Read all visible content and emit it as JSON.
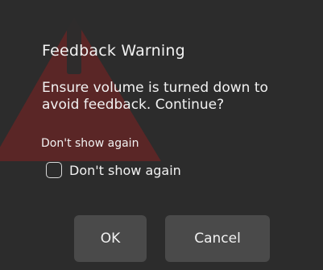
{
  "dialog": {
    "title": "Feedback Warning",
    "message": "Ensure volume is turned down to avoid feedback. Continue?",
    "hint": "Don't show again",
    "checkbox": {
      "label": "Don't show again",
      "checked": false
    },
    "buttons": {
      "ok": "OK",
      "cancel": "Cancel"
    },
    "background_icon": "warning-triangle-icon"
  },
  "colors": {
    "dialog_bg": "#2c2c2c",
    "button_bg": "#4a4a4a",
    "text": "#f2f2f2",
    "warning_red": "#6a2424"
  }
}
